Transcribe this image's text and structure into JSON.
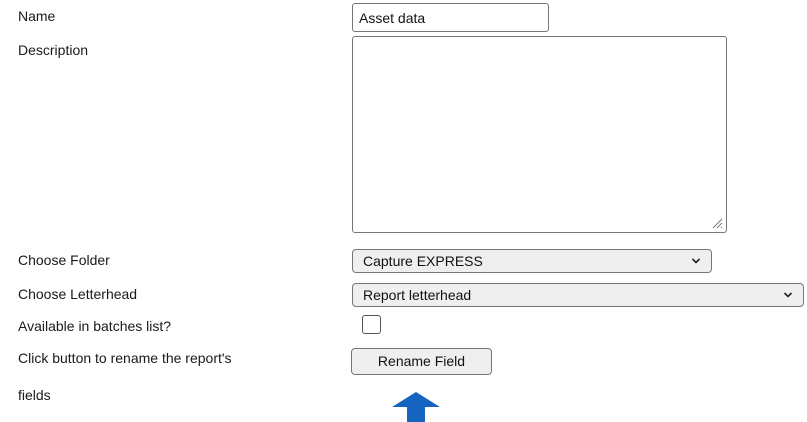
{
  "form": {
    "name_label": "Name",
    "name_value": "Asset data",
    "description_label": "Description",
    "description_value": "",
    "folder_label": "Choose Folder",
    "folder_value": "Capture EXPRESS",
    "letterhead_label": "Choose Letterhead",
    "letterhead_value": "Report letterhead",
    "batches_label": "Available in batches list?",
    "batches_checked": false,
    "rename_label_line1": "Click button to rename the report's",
    "rename_label_line2": "fields",
    "rename_button_label": "Rename Field"
  },
  "icons": {
    "select_arrow": "chevron-down-icon",
    "pointer_arrow": "arrow-up-icon",
    "resize": "resize-grip-icon"
  },
  "colors": {
    "pointer_arrow": "#1565c0",
    "control_bg": "#efefef",
    "control_border": "#767676"
  }
}
